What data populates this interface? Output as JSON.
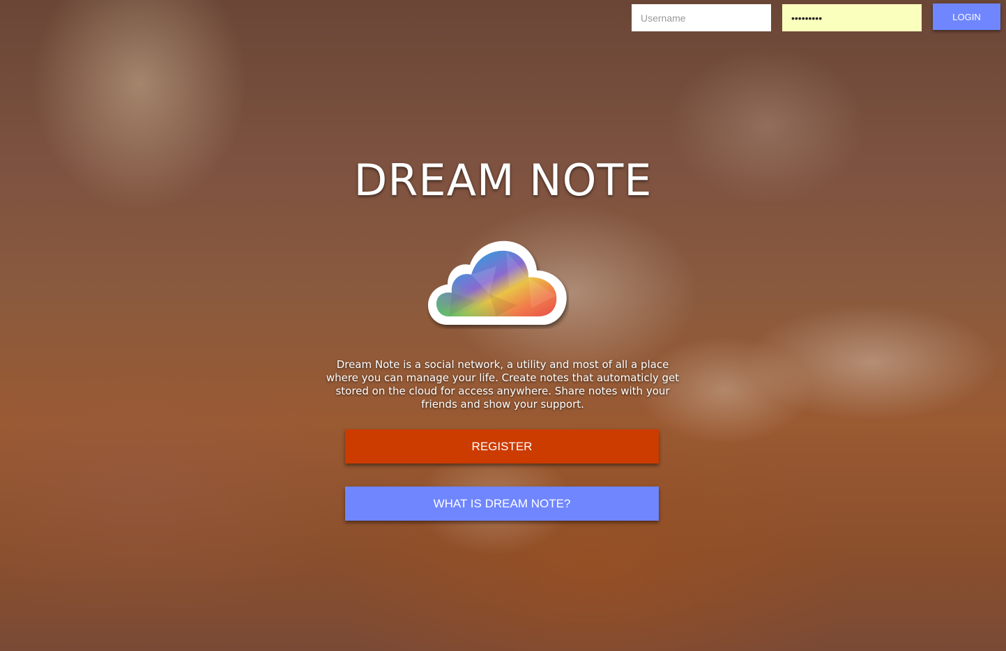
{
  "colors": {
    "login_button": "#6f86ff",
    "register_button": "#cc3b00",
    "about_button": "#6f86ff",
    "password_field_bg": "#faffbd"
  },
  "header": {
    "username_placeholder": "Username",
    "password_value": "•••••••••",
    "login_label": "LOGIN"
  },
  "hero": {
    "title": "DREAM NOTE",
    "logo_icon": "rainbow-cloud-icon",
    "description": "Dream Note is a social network, a utility and most of all a place where you can manage your life. Create notes that automaticly get stored on the cloud for access anywhere. Share notes with your friends and show your support.",
    "register_label": "REGISTER",
    "about_label": "WHAT IS DREAM NOTE?"
  }
}
